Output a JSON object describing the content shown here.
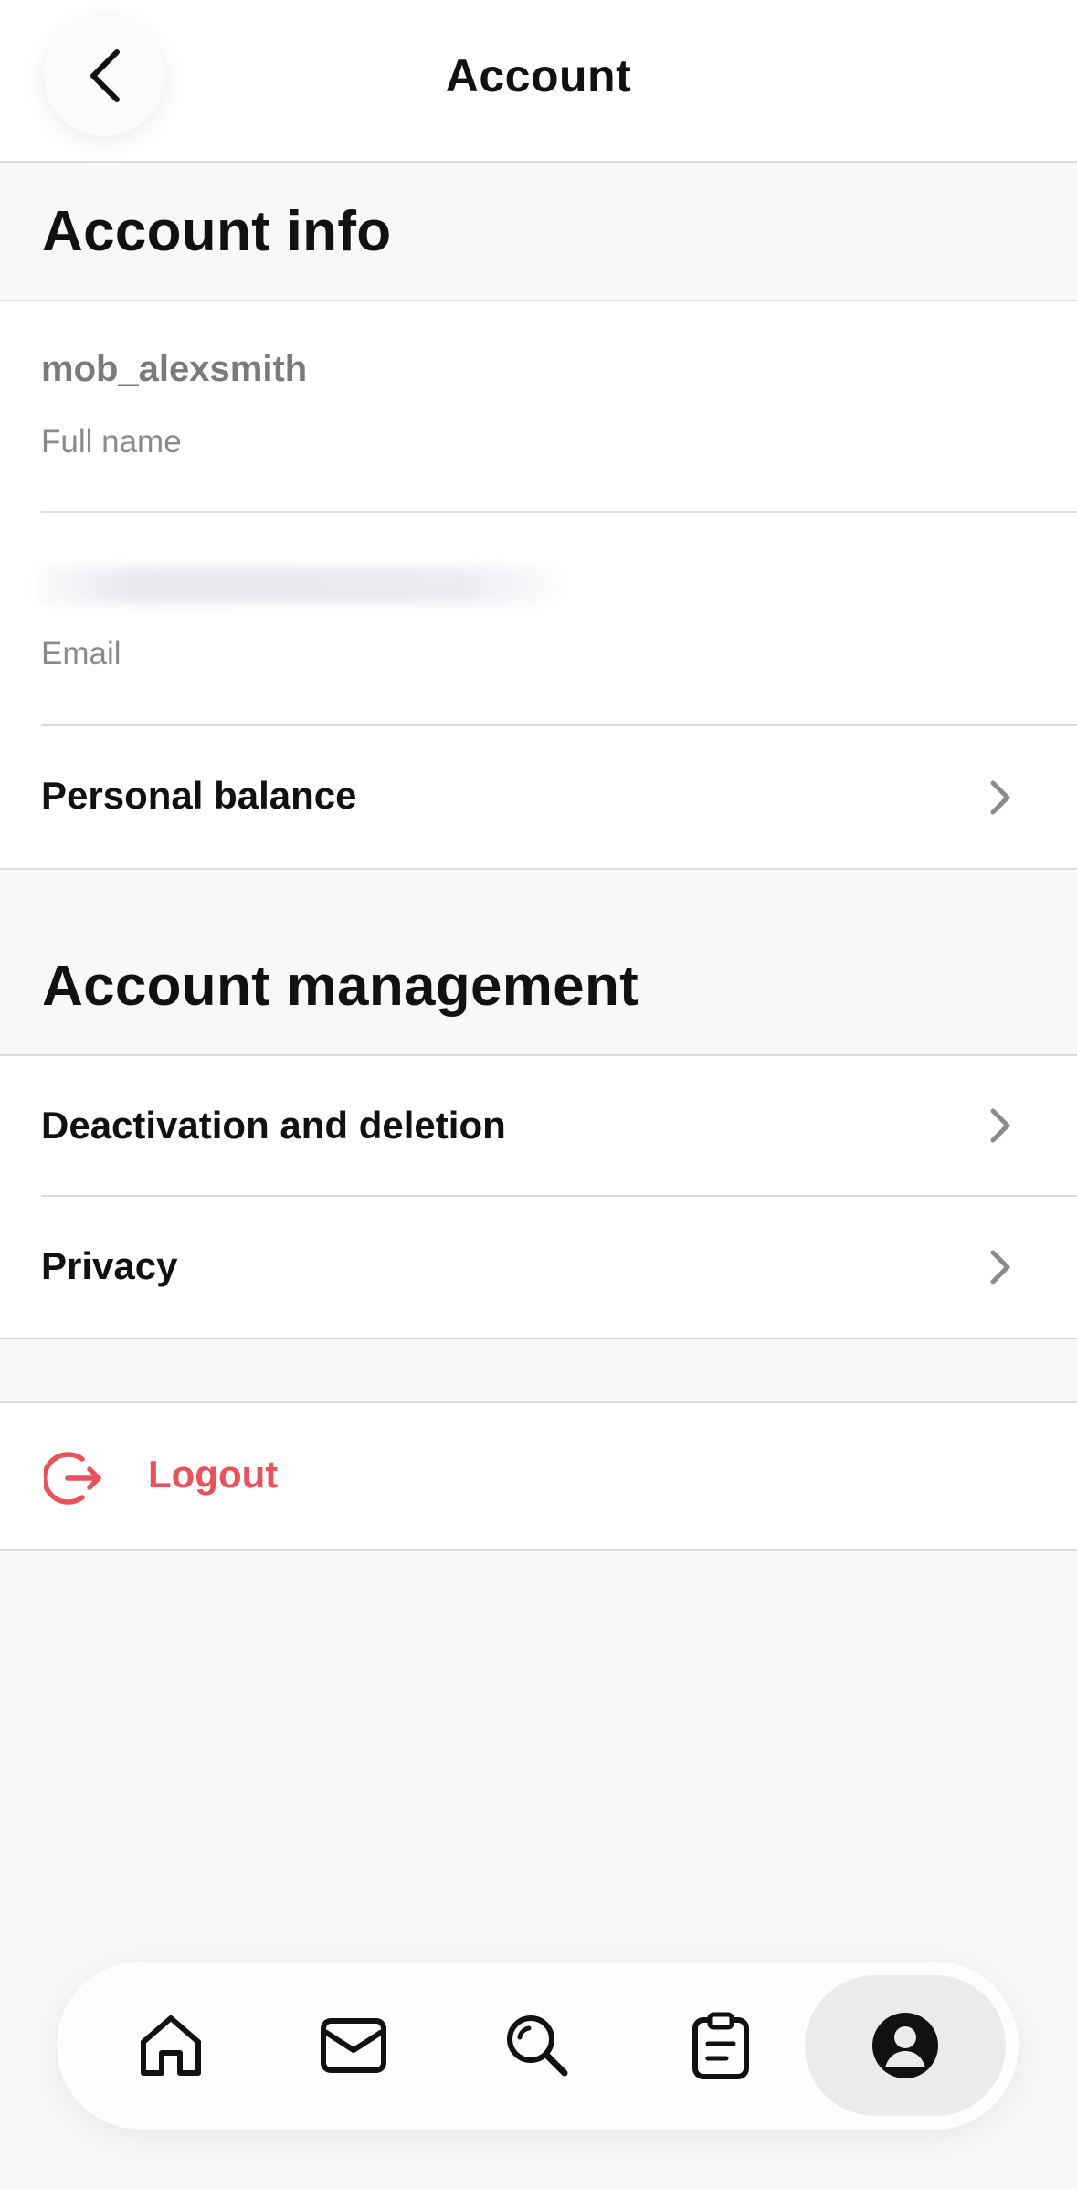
{
  "header": {
    "title": "Account"
  },
  "account_info": {
    "title": "Account info",
    "full_name": {
      "value": "mob_alexsmith",
      "label": "Full name"
    },
    "email": {
      "label": "Email"
    },
    "personal_balance_label": "Personal balance"
  },
  "account_management": {
    "title": "Account management",
    "items": [
      {
        "label": "Deactivation and deletion"
      },
      {
        "label": "Privacy"
      }
    ]
  },
  "logout": {
    "label": "Logout",
    "color": "#e8535b"
  },
  "tabbar": {
    "items": [
      {
        "icon": "home-icon"
      },
      {
        "icon": "mail-icon"
      },
      {
        "icon": "search-icon"
      },
      {
        "icon": "clipboard-icon"
      },
      {
        "icon": "profile-icon",
        "active": true
      }
    ]
  }
}
